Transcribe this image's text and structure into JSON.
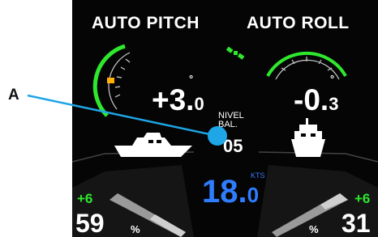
{
  "callout": {
    "label": "A"
  },
  "header": {
    "pitch_title": "AUTO PITCH",
    "roll_title": "AUTO ROLL"
  },
  "pitch": {
    "value_main": "+3.",
    "value_decimal": "0",
    "unit": "°"
  },
  "roll": {
    "value_main": "-0.",
    "value_decimal": "3",
    "unit": "°"
  },
  "trim_level": {
    "label_line1": "NIVEL",
    "label_line2": "BAL.",
    "value": "05"
  },
  "speed": {
    "unit": "KTS",
    "value_main": "18.",
    "value_decimal": "0"
  },
  "left_tab": {
    "delta": "+6",
    "percent": "59",
    "percent_sign": "%"
  },
  "right_tab": {
    "delta": "+6",
    "percent": "31",
    "percent_sign": "%"
  },
  "icons": {
    "satellite": "gps-satellite-icon",
    "boat_side": "boat-side-icon",
    "boat_front": "boat-front-icon"
  },
  "colors": {
    "accent_green": "#2ee82e",
    "speed_blue": "#2f7dff",
    "indicator_orange": "#ffb000",
    "callout_blue": "#1ea6e6"
  }
}
